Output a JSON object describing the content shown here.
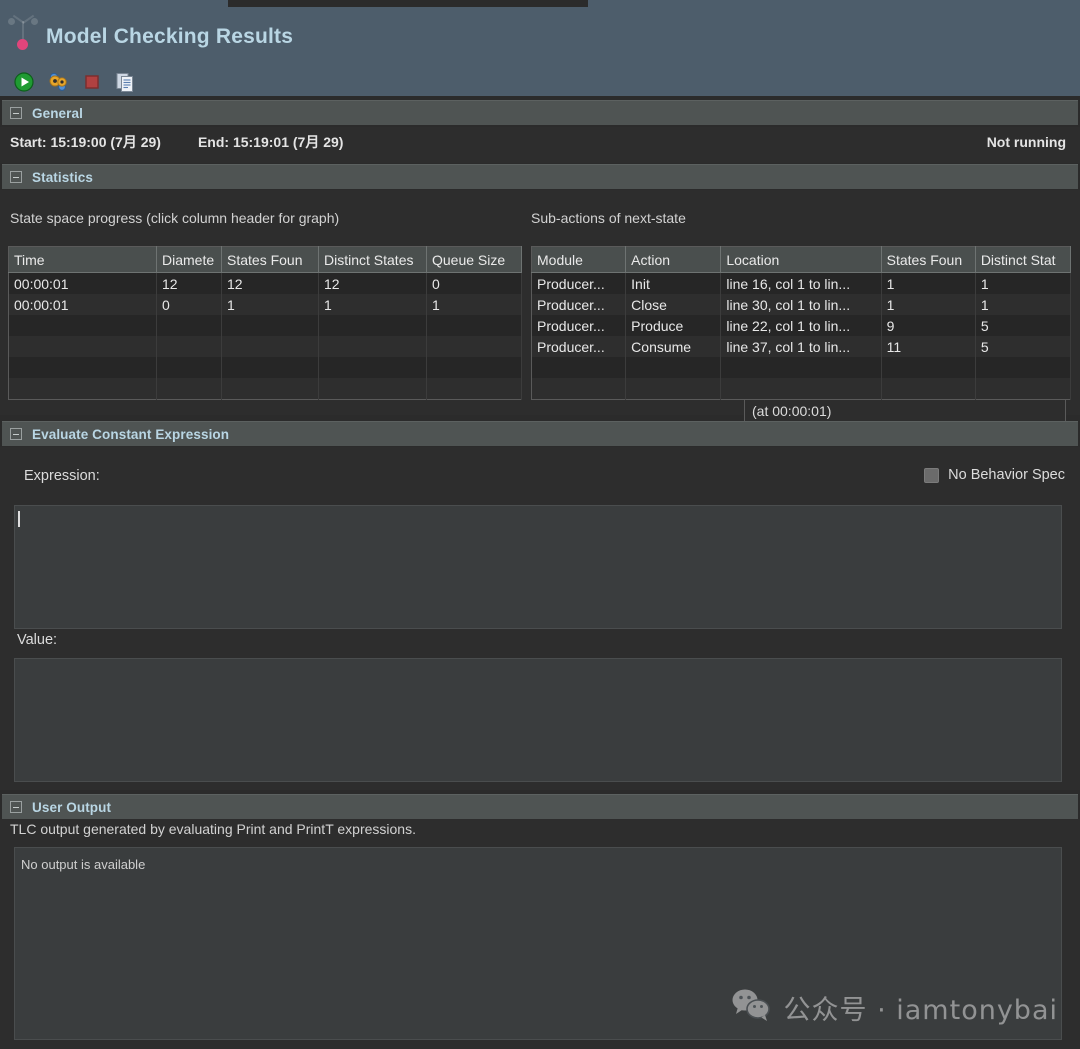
{
  "window": {
    "title": "Model Checking Results"
  },
  "toolbar": {
    "buttons": [
      {
        "name": "run-icon",
        "label": "Run"
      },
      {
        "name": "gears-icon",
        "label": "Model Checking Options"
      },
      {
        "name": "stop-icon",
        "label": "Stop"
      },
      {
        "name": "copy-icon",
        "label": "Copy"
      }
    ]
  },
  "general": {
    "section_title": "General",
    "start": "Start: 15:19:00 (7月 29)",
    "end": "End: 15:19:01 (7月 29)",
    "status": "Not running"
  },
  "statistics": {
    "section_title": "Statistics",
    "progress_label": "State space progress (click column header for graph)",
    "subactions_label": "Sub-actions of next-state",
    "at_time": "(at 00:00:01)",
    "progress_table": {
      "columns": [
        "Time",
        "Diamete",
        "States Foun",
        "Distinct States",
        "Queue Size"
      ],
      "rows": [
        [
          "00:00:01",
          "12",
          "12",
          "12",
          "0"
        ],
        [
          "00:00:01",
          "0",
          "1",
          "1",
          "1"
        ]
      ],
      "blank_rows": 4
    },
    "subactions_table": {
      "columns": [
        "Module",
        "Action",
        "Location",
        "States Foun",
        "Distinct Stat"
      ],
      "rows": [
        [
          "Producer...",
          "Init",
          "line 16, col 1 to lin...",
          "1",
          "1"
        ],
        [
          "Producer...",
          "Close",
          "line 30, col 1 to lin...",
          "1",
          "1"
        ],
        [
          "Producer...",
          "Produce",
          "line 22, col 1 to lin...",
          "9",
          "5"
        ],
        [
          "Producer...",
          "Consume",
          "line 37, col 1 to lin...",
          "11",
          "5"
        ]
      ],
      "blank_rows": 2
    }
  },
  "evaluate": {
    "section_title": "Evaluate Constant Expression",
    "expression_label": "Expression:",
    "no_behavior_spec_label": "No Behavior Spec",
    "no_behavior_spec_checked": false,
    "expression_value": "",
    "value_label": "Value:",
    "value_value": ""
  },
  "user_output": {
    "section_title": "User Output",
    "description": "TLC output generated by evaluating Print and PrintT expressions.",
    "content": "No output is available"
  },
  "watermark": {
    "text": "公众号 · iamtonybai"
  },
  "colors": {
    "header_bg": "#4d5d6b",
    "header_title": "#b9d6e4",
    "section_bar": "#4f5453",
    "body_bg": "#2d2d2d",
    "field_bg": "#3a3d3e",
    "accent_dot": "#e0457b",
    "run_green": "#1f9b32",
    "stop_red": "#b04141"
  }
}
